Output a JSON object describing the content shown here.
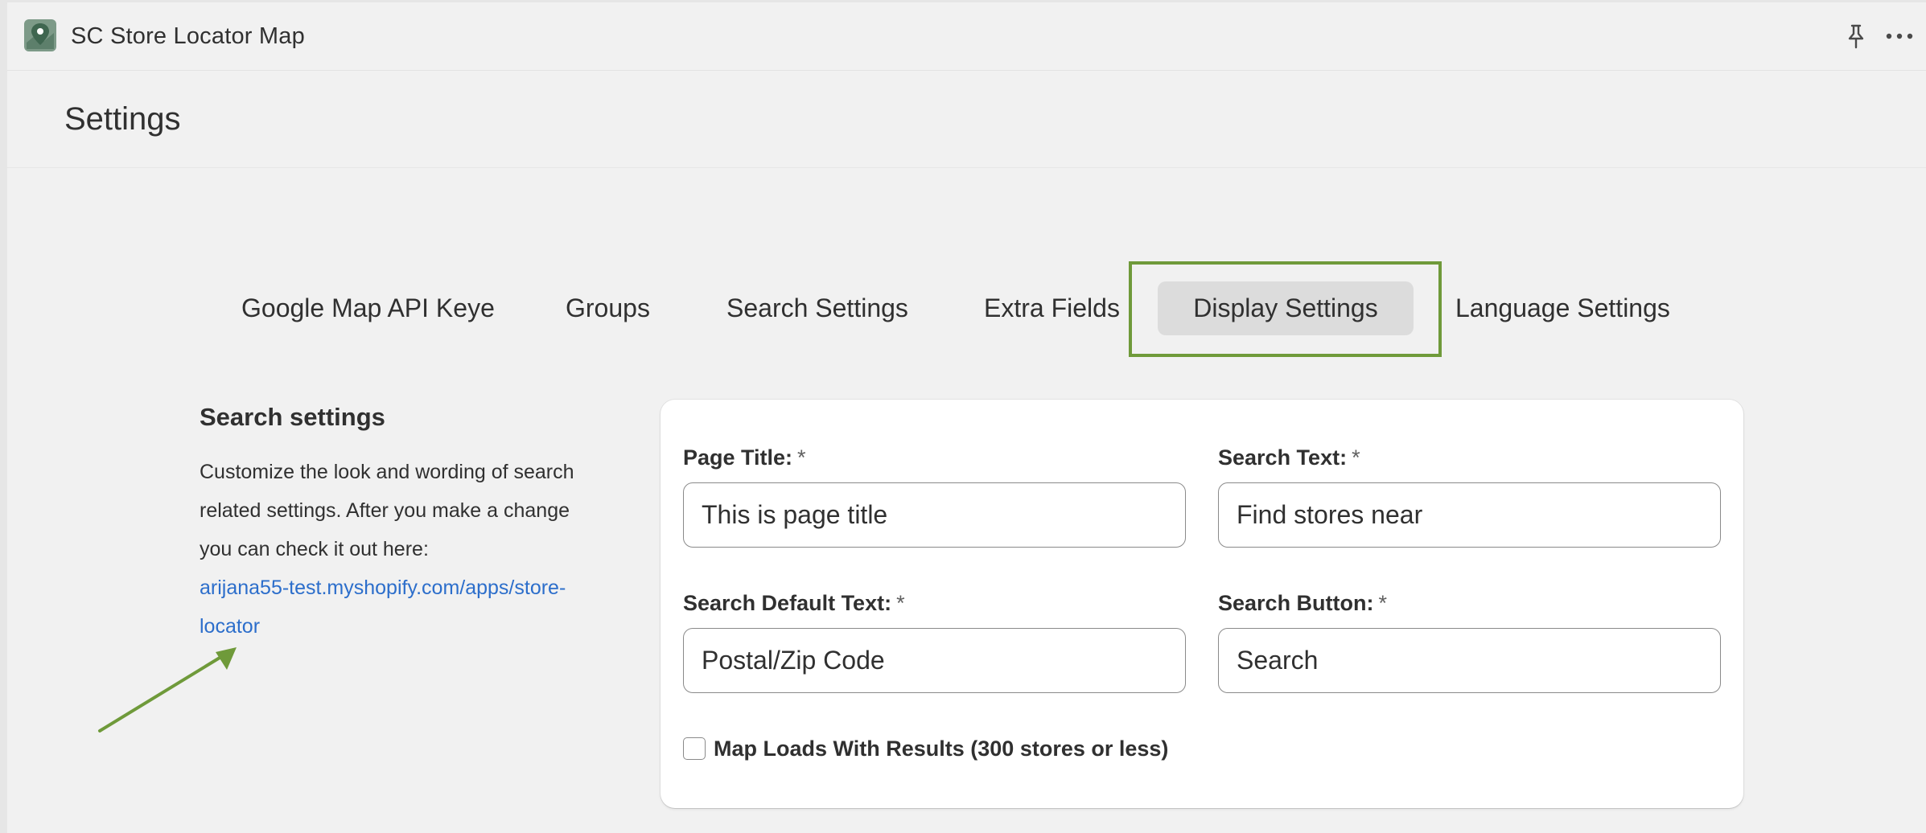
{
  "app": {
    "title": "SC Store Locator Map",
    "logo_icon": "map-pin-logo-icon",
    "pin_icon": "pin-icon",
    "more_icon": "more-horizontal-icon"
  },
  "page": {
    "title": "Settings"
  },
  "tabs": [
    {
      "label": "Google Map API Keye",
      "active": false
    },
    {
      "label": "Groups",
      "active": false
    },
    {
      "label": "Search Settings",
      "active": false
    },
    {
      "label": "Extra Fields",
      "active": false
    },
    {
      "label": "Display Settings",
      "active": true
    },
    {
      "label": "Language Settings",
      "active": false
    }
  ],
  "section": {
    "heading": "Search settings",
    "description": "Customize the look and wording of search related settings. After you make a change you can check it out here:",
    "link": "arijana55-test.myshopify.com/apps/store-locator"
  },
  "form": {
    "page_title": {
      "label": "Page Title:",
      "required": "*",
      "value": "This is page title"
    },
    "search_text": {
      "label": "Search Text:",
      "required": "*",
      "value": "Find stores near"
    },
    "search_default_text": {
      "label": "Search Default Text:",
      "required": "*",
      "value": "Postal/Zip Code"
    },
    "search_button": {
      "label": "Search Button:",
      "required": "*",
      "value": "Search"
    },
    "map_loads": {
      "label": "Map Loads With Results (300 stores or less)",
      "checked": false
    }
  },
  "colors": {
    "accent_highlight": "#6f9a3a",
    "link": "#2c6ecb",
    "background": "#f1f1f1",
    "active_tab_bg": "#dcdcdc"
  }
}
